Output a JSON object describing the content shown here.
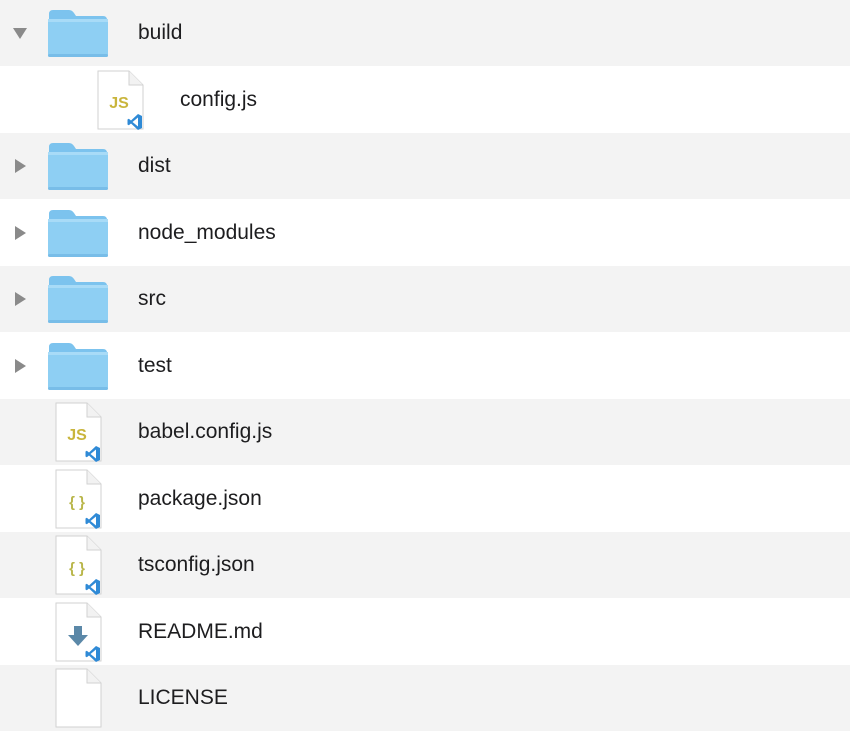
{
  "files": [
    {
      "name": "build",
      "kind": "folder",
      "expanded": true,
      "depth": 0
    },
    {
      "name": "config.js",
      "kind": "js",
      "depth": 1
    },
    {
      "name": "dist",
      "kind": "folder",
      "expanded": false,
      "depth": 0
    },
    {
      "name": "node_modules",
      "kind": "folder",
      "expanded": false,
      "depth": 0
    },
    {
      "name": "src",
      "kind": "folder",
      "expanded": false,
      "depth": 0
    },
    {
      "name": "test",
      "kind": "folder",
      "expanded": false,
      "depth": 0
    },
    {
      "name": "babel.config.js",
      "kind": "js",
      "depth": 0
    },
    {
      "name": "package.json",
      "kind": "json",
      "depth": 0
    },
    {
      "name": "tsconfig.json",
      "kind": "json",
      "depth": 0
    },
    {
      "name": "README.md",
      "kind": "markdown",
      "depth": 0
    },
    {
      "name": "LICENSE",
      "kind": "plain",
      "depth": 0
    }
  ],
  "icon_glyphs": {
    "js": "JS",
    "json": "{ }"
  },
  "colors": {
    "row_alternate": "#f3f3f3",
    "row_default": "#ffffff",
    "folder": "#8ecff3",
    "js_glyph": "#c9b53c",
    "json_glyph": "#b9b64a",
    "vscode_badge": "#2f8ad6",
    "markdown_arrow": "#5b88a8",
    "disclosure": "#8a8a8a",
    "text": "#1d1d1f"
  }
}
